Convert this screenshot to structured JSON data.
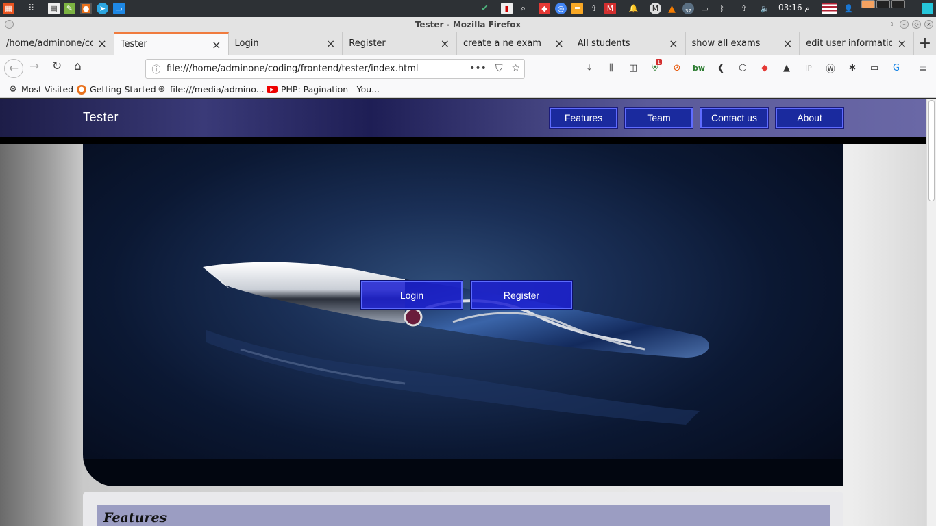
{
  "panel": {
    "clock": "03:16 م",
    "battery_badge": "37"
  },
  "window": {
    "title": "Tester - Mozilla Firefox"
  },
  "tabs": [
    {
      "label": "/home/adminone/coding/frontend/tester/",
      "active": false
    },
    {
      "label": "Tester",
      "active": true
    },
    {
      "label": "Login",
      "active": false
    },
    {
      "label": "Register",
      "active": false
    },
    {
      "label": "create a ne exam",
      "active": false
    },
    {
      "label": "All students",
      "active": false
    },
    {
      "label": "show all exams",
      "active": false
    },
    {
      "label": "edit user information",
      "active": false
    }
  ],
  "toolbar": {
    "url": "file:///home/adminone/coding/frontend/tester/index.html",
    "ublock_badge": "1"
  },
  "bookmarks": [
    {
      "label": "Most Visited",
      "icon": "gear-icon"
    },
    {
      "label": "Getting Started",
      "icon": "firefox-icon"
    },
    {
      "label": "file:///media/admino...",
      "icon": "globe-icon"
    },
    {
      "label": "PHP: Pagination - You...",
      "icon": "youtube-icon"
    }
  ],
  "site": {
    "brand": "Tester",
    "nav": [
      "Features",
      "Team",
      "Contact us",
      "About"
    ],
    "hero_buttons": {
      "login": "Login",
      "register": "Register"
    },
    "section_title": "Features"
  },
  "colors": {
    "nav_button_bg": "#1a2a9e",
    "nav_button_border": "#5f6cff",
    "hero_button_bg": "#1c20d2",
    "tab_accent": "#f07b3e",
    "features_bar": "#9b9dc2"
  }
}
